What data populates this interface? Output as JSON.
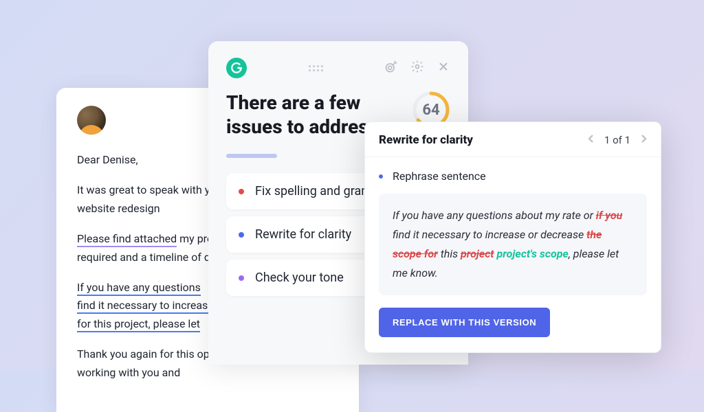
{
  "email": {
    "greeting": "Dear Denise,",
    "p1": "It was great to speak with you about your upcoming website redesign",
    "p2_lead": "Please find attached",
    "p2_rest": " my proposal for the services required and a timeline of deliverables we discussed",
    "p3_a": "If you have any questions",
    "p3_b": "find it necessary to increase",
    "p3_c": "for this project, please let",
    "p4": "Thank you again for this opportunity. I look forward to working with you and"
  },
  "panel": {
    "title": "There are a few issues to address",
    "score": "64",
    "items": {
      "0": {
        "label": "Fix spelling and grammar"
      },
      "1": {
        "label": "Rewrite for clarity"
      },
      "2": {
        "label": "Check your tone"
      }
    }
  },
  "popover": {
    "title": "Rewrite for clarity",
    "pager": "1 of 1",
    "bullet": "Rephrase sentence",
    "rewrite": {
      "seg1": "If you have any questions about my rate or ",
      "strike1": "if you",
      "seg2": " find it necessary to increase or decrease ",
      "strike2": "the scope for",
      "seg3": " this ",
      "strike3": "project",
      "seg4": " ",
      "insert": "project's scope",
      "seg5": ", please let me know."
    },
    "button": "REPLACE WITH THIS VERSION"
  }
}
